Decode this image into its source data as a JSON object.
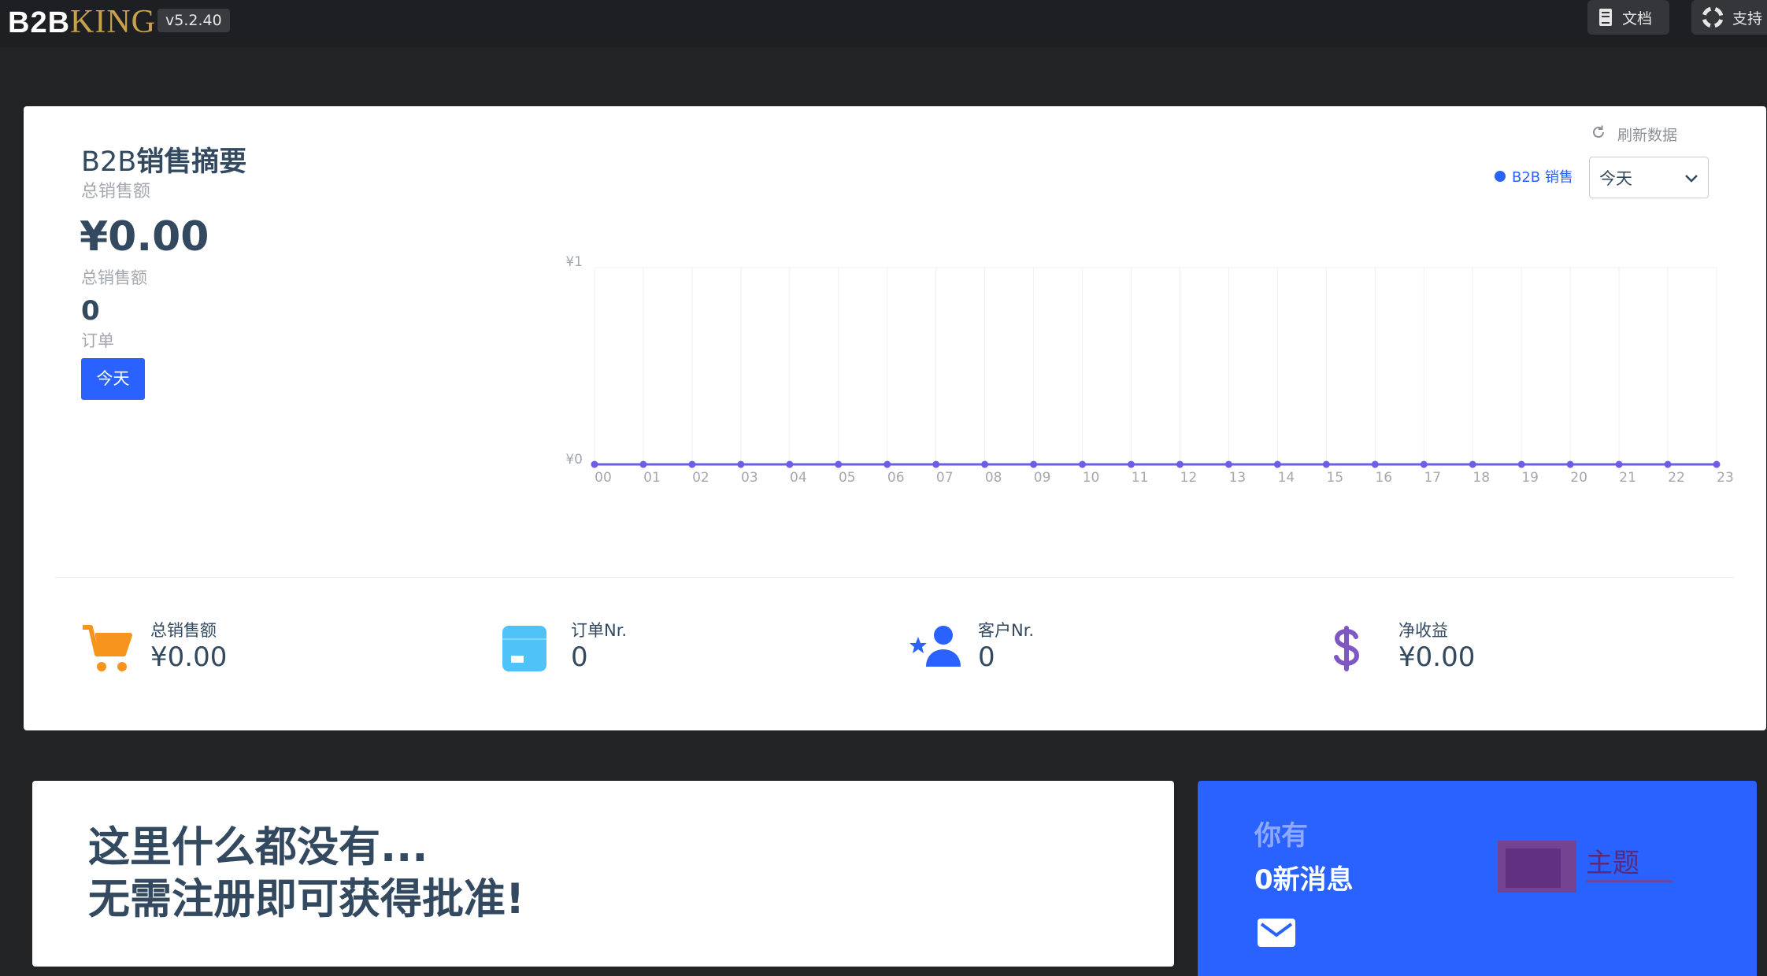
{
  "app": {
    "logo_b2": "B2B",
    "logo_king": "KING",
    "version": "v5.2.40",
    "docs_label": "文档",
    "support_label": "支持"
  },
  "sales_summary": {
    "title_prefix": "B2B",
    "title_suffix": "销售摘要",
    "subtitle": "总销售额",
    "total_value": "¥0.00",
    "total_label": "总销售额",
    "orders_value": "0",
    "orders_label": "订单",
    "today_button": "今天",
    "refresh_label": "刷新数据",
    "legend_label": "B2B 销售",
    "period_selected": "今天"
  },
  "chart_data": {
    "type": "line",
    "x": [
      "00",
      "01",
      "02",
      "03",
      "04",
      "05",
      "06",
      "07",
      "08",
      "09",
      "10",
      "11",
      "12",
      "13",
      "14",
      "15",
      "16",
      "17",
      "18",
      "19",
      "20",
      "21",
      "22",
      "23"
    ],
    "series": [
      {
        "name": "B2B 销售",
        "values": [
          0,
          0,
          0,
          0,
          0,
          0,
          0,
          0,
          0,
          0,
          0,
          0,
          0,
          0,
          0,
          0,
          0,
          0,
          0,
          0,
          0,
          0,
          0,
          0
        ]
      }
    ],
    "yticks": [
      "¥1",
      "¥0"
    ],
    "ylim": [
      0,
      1
    ],
    "grid": true,
    "legend": "top-right",
    "color": "#6c5ce7"
  },
  "stats": [
    {
      "label": "总销售额",
      "value": "¥0.00",
      "icon": "cart-icon",
      "color": "#f7941d"
    },
    {
      "label": "订单Nr.",
      "value": "0",
      "icon": "box-icon",
      "color": "#4fc3f7"
    },
    {
      "label": "客户Nr.",
      "value": "0",
      "icon": "customer-star-icon",
      "color": "#2962ff"
    },
    {
      "label": "净收益",
      "value": "¥0.00",
      "icon": "dollar-icon",
      "color": "#7e57c2"
    }
  ],
  "empty_card": {
    "line1": "这里什么都没有...",
    "line2": "无需注册即可获得批准!"
  },
  "messages": {
    "line1": "你有",
    "line2": "0新消息"
  },
  "watermark": {
    "text": "主题"
  }
}
